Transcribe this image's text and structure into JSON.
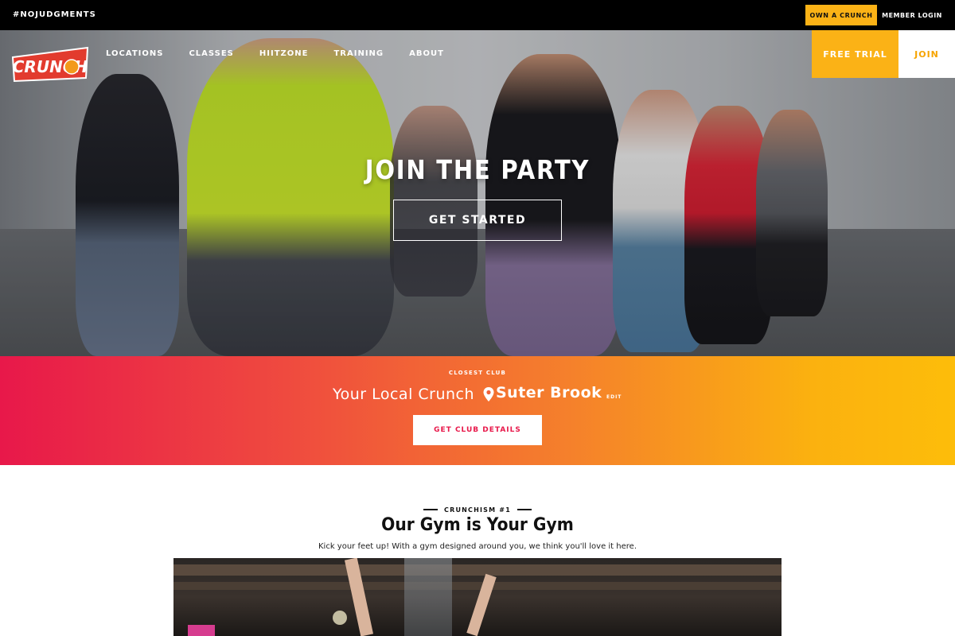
{
  "topbar": {
    "tagline": "#NOJUDGMENTS",
    "own_label": "OWN A CRUNCH",
    "member_label": "MEMBER LOGIN"
  },
  "brand": {
    "logo_text": "CRUNCH"
  },
  "nav": {
    "items": [
      {
        "label": "LOCATIONS"
      },
      {
        "label": "CLASSES"
      },
      {
        "label": "HIITZONE"
      },
      {
        "label": "TRAINING"
      },
      {
        "label": "ABOUT"
      }
    ],
    "free_trial_label": "FREE TRIAL",
    "join_label": "JOIN"
  },
  "hero": {
    "title": "JOIN THE PARTY",
    "cta_label": "GET STARTED"
  },
  "club": {
    "eyebrow": "CLOSEST CLUB",
    "local_label": "Your Local Crunch",
    "club_name": "Suter Brook",
    "edit_label": "EDIT",
    "details_label": "GET CLUB DETAILS"
  },
  "crunchism": {
    "eyebrow": "CRUNCHISM #1",
    "heading": "Our Gym is Your Gym",
    "subtext": "Kick your feet up! With a gym designed around you, we think you'll love it here."
  },
  "colors": {
    "accent_yellow": "#fbb216",
    "gradient_start": "#e8184a",
    "gradient_end": "#fdbd0a",
    "topbar_bg": "#000000"
  }
}
